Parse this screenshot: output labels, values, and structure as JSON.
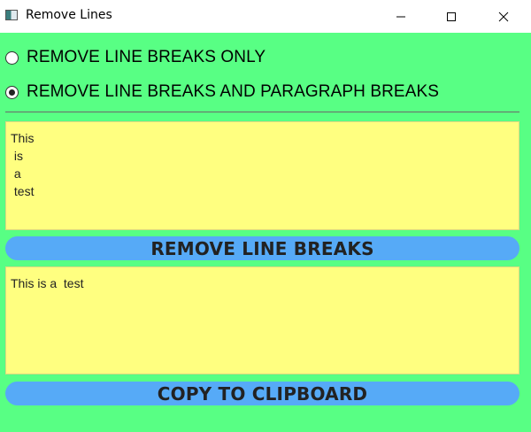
{
  "window": {
    "title": "Remove Lines"
  },
  "options": {
    "line_breaks_only": {
      "label": "REMOVE LINE BREAKS ONLY",
      "selected": false
    },
    "line_and_paragraph": {
      "label": "REMOVE LINE BREAKS AND PARAGRAPH BREAKS",
      "selected": true
    }
  },
  "input": {
    "value": "This\n is\n a\n test"
  },
  "output": {
    "value": "This is a  test"
  },
  "buttons": {
    "remove_label": "REMOVE LINE BREAKS",
    "copy_label": "COPY TO CLIPBOARD"
  },
  "colors": {
    "background": "#58ff84",
    "textbox": "#ffff80",
    "button": "#56aaf7"
  }
}
